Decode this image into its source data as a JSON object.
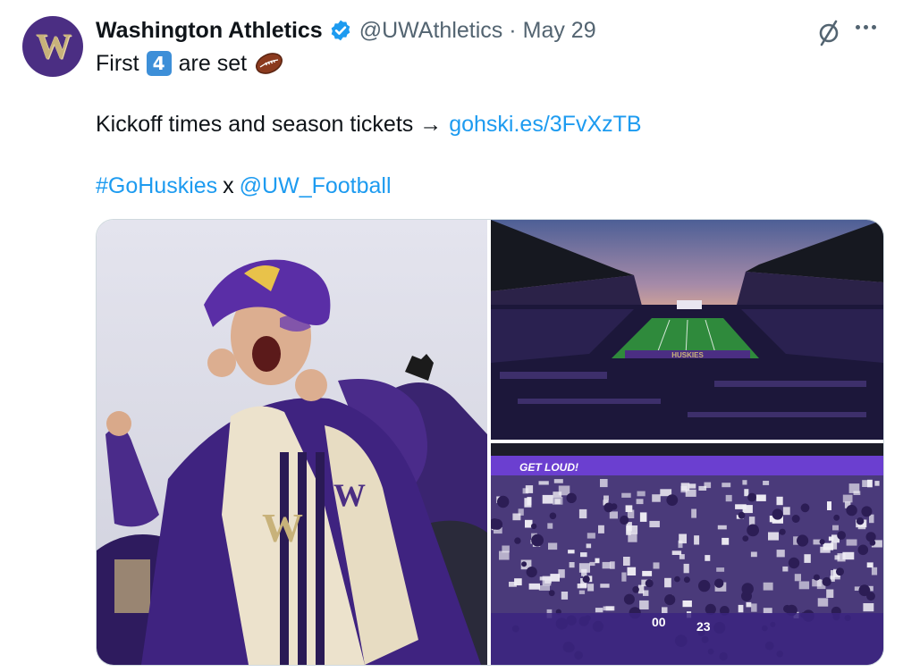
{
  "account": {
    "avatar_letter": "W",
    "display_name": "Washington Athletics",
    "handle": "@UWAthletics",
    "separator": "·",
    "date": "May 29"
  },
  "tweet": {
    "line1_before": "First",
    "line1_keycap": "4",
    "line1_after": "are set",
    "line2_text": "Kickoff times and season tickets →",
    "line2_link": "gohski.es/3FvXzTB",
    "line3_hashtag": "#GoHuskies",
    "line3_mid": "x",
    "line3_mention": "@UW_Football"
  },
  "media": {
    "photo2_endzone_text": "HUSKIES",
    "photo3_banner_text": "GET LOUD!"
  },
  "icons": {
    "verified": "verified-badge-icon",
    "grok": "grok-icon",
    "more": "more-options-icon",
    "football": "american-football-emoji"
  },
  "colors": {
    "link": "#1d9bf0",
    "secondary_text": "#536471",
    "husky_purple": "#4b2e83",
    "husky_gold": "#c8b27a"
  }
}
